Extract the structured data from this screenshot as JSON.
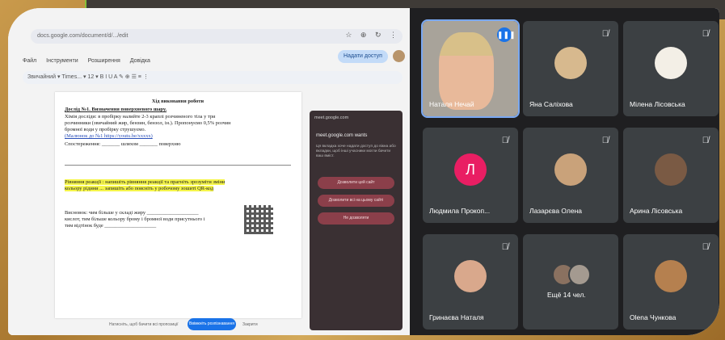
{
  "browser": {
    "url": "docs.google.com/document/d/.../edit",
    "icons": "☆ ⊕ ↻ ⋮"
  },
  "docs": {
    "menu": [
      "Файл",
      "Інструменти",
      "Розширення",
      "Довідка"
    ],
    "share_label": "Надати доступ",
    "toolbar_text": "Звичайний ▾  Times... ▾  12 ▾  B  I  U  A  ✎  ⊕  ☰  ≡  ⋮",
    "title": "Хід виконання роботи",
    "lines": [
      "Дослід №1. Визначення поверхневого шару.",
      "Хімія досліди: в пробірку налийте 2-3 краплі розчиненого тіла у три",
      "розчинники (звичайний жир, бензин, бензол, ін.). Пропонуємо 0,5% розчин",
      "бромної води у пробірку струшуємо.",
      "(Малюнок до №1 https://youtu.be/xxxxx)",
      "Спостереження: _______ шляхом _______ поверхню",
      "Рівняння реакції : напишіть рівняння реакції та прагніть зрозуміти зміни",
      "кольору рідини ... запишіть або поясніть у робочому зошиті QR-код",
      "Висновок: чим більше у складі жиру ____________________",
      "кислот, тим більше кольору брому і бромної води присутнього і",
      "тим відтінок буде ____________________"
    ],
    "bottom_note": "Натисніть, щоб бачити всі пропозиції",
    "bottom_button": "Ввімкніть розпізнавання",
    "bottom_cancel": "Закрити"
  },
  "popup": {
    "header": "meet.google.com",
    "title": "meet.google.com wants",
    "description": "Ця вкладка хоче надати доступ до вікна або вкладки, щоб інші учасники могли бачити ваш вміст.",
    "buttons": [
      "Дозволити цей сайт",
      "Дозволити всі на цьому сайті",
      "Не дозволяти"
    ]
  },
  "meet": {
    "participants": [
      {
        "name": "Наталя Нечай",
        "initial": "",
        "muted": false,
        "speaking": true
      },
      {
        "name": "Яна Саліхова",
        "initial": "",
        "muted": true
      },
      {
        "name": "Мілена Лісовська",
        "initial": "",
        "muted": true
      },
      {
        "name": "Людмила Прокоп...",
        "initial": "Л",
        "muted": true
      },
      {
        "name": "Лазарєва Олена",
        "initial": "",
        "muted": true
      },
      {
        "name": "Арина Лісовська",
        "initial": "",
        "muted": true
      },
      {
        "name": "Гринаєва Наталя",
        "initial": "",
        "muted": true
      },
      {
        "name": "Ещё 14 чел.",
        "initial": "",
        "muted": false
      },
      {
        "name": "Olena Чункова",
        "initial": "",
        "muted": true
      }
    ],
    "mic_off_glyph": "🎙̸",
    "speaking_glyph": "❚❚❚"
  },
  "colors": {
    "meet_bg": "#1f1f21",
    "tile_bg": "#3c4043",
    "accent": "#1a73e8",
    "avatar_l": "#e91e63",
    "popup_button": "#8b3f4a"
  }
}
